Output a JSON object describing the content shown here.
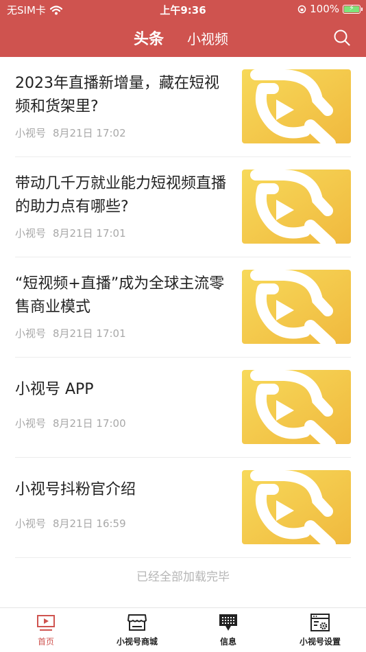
{
  "status_bar": {
    "carrier": "无SIM卡",
    "time": "上午9:36",
    "battery": "100%"
  },
  "nav": {
    "tab_active": "头条",
    "tab_other": "小视频"
  },
  "articles": [
    {
      "title": "2023年直播新增量，藏在短视频和货架里?",
      "source": "小视号",
      "time": "8月21日 17:02"
    },
    {
      "title": "带动几千万就业能力短视频直播的助力点有哪些?",
      "source": "小视号",
      "time": "8月21日 17:01"
    },
    {
      "title": "“短视频+直播”成为全球主流零售商业模式",
      "source": "小视号",
      "time": "8月21日 17:01"
    },
    {
      "title": "小视号 APP",
      "source": "小视号",
      "time": "8月21日 17:00"
    },
    {
      "title": "小视号抖粉官介绍",
      "source": "小视号",
      "time": "8月21日 16:59"
    }
  ],
  "list_end_text": "已经全部加载完毕",
  "tabbar": {
    "home": "首页",
    "mall": "小视号商城",
    "messages": "信息",
    "settings": "小视号设置"
  },
  "colors": {
    "brand": "#cf534f",
    "thumb_yellow": "#f2c94c"
  },
  "icons": [
    "wifi-icon",
    "orientation-lock-icon",
    "battery-icon",
    "search-icon",
    "video-play-logo-icon",
    "tv-icon",
    "store-icon",
    "chat-icon",
    "settings-window-icon"
  ]
}
